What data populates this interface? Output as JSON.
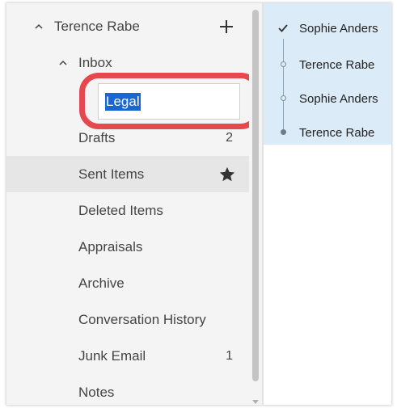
{
  "folders": {
    "account": {
      "name": "Terence Rabe"
    },
    "inbox": {
      "label": "Inbox"
    },
    "editing": {
      "value": "Legal"
    },
    "items": [
      {
        "label": "Drafts",
        "count": "2"
      },
      {
        "label": "Sent Items",
        "count": ""
      },
      {
        "label": "Deleted Items",
        "count": ""
      },
      {
        "label": "Appraisals",
        "count": ""
      },
      {
        "label": "Archive",
        "count": ""
      },
      {
        "label": "Conversation History",
        "count": ""
      },
      {
        "label": "Junk Email",
        "count": "1"
      },
      {
        "label": "Notes",
        "count": ""
      }
    ]
  },
  "messages": {
    "thread": [
      {
        "sender": "Sophie Anders"
      },
      {
        "sender": "Terence Rabe"
      },
      {
        "sender": "Sophie Anders"
      },
      {
        "sender": "Terence Rabe"
      }
    ]
  },
  "colors": {
    "highlight": "#e5484d",
    "selection": "#1a66d1",
    "thread_bg": "#dcebf8"
  }
}
